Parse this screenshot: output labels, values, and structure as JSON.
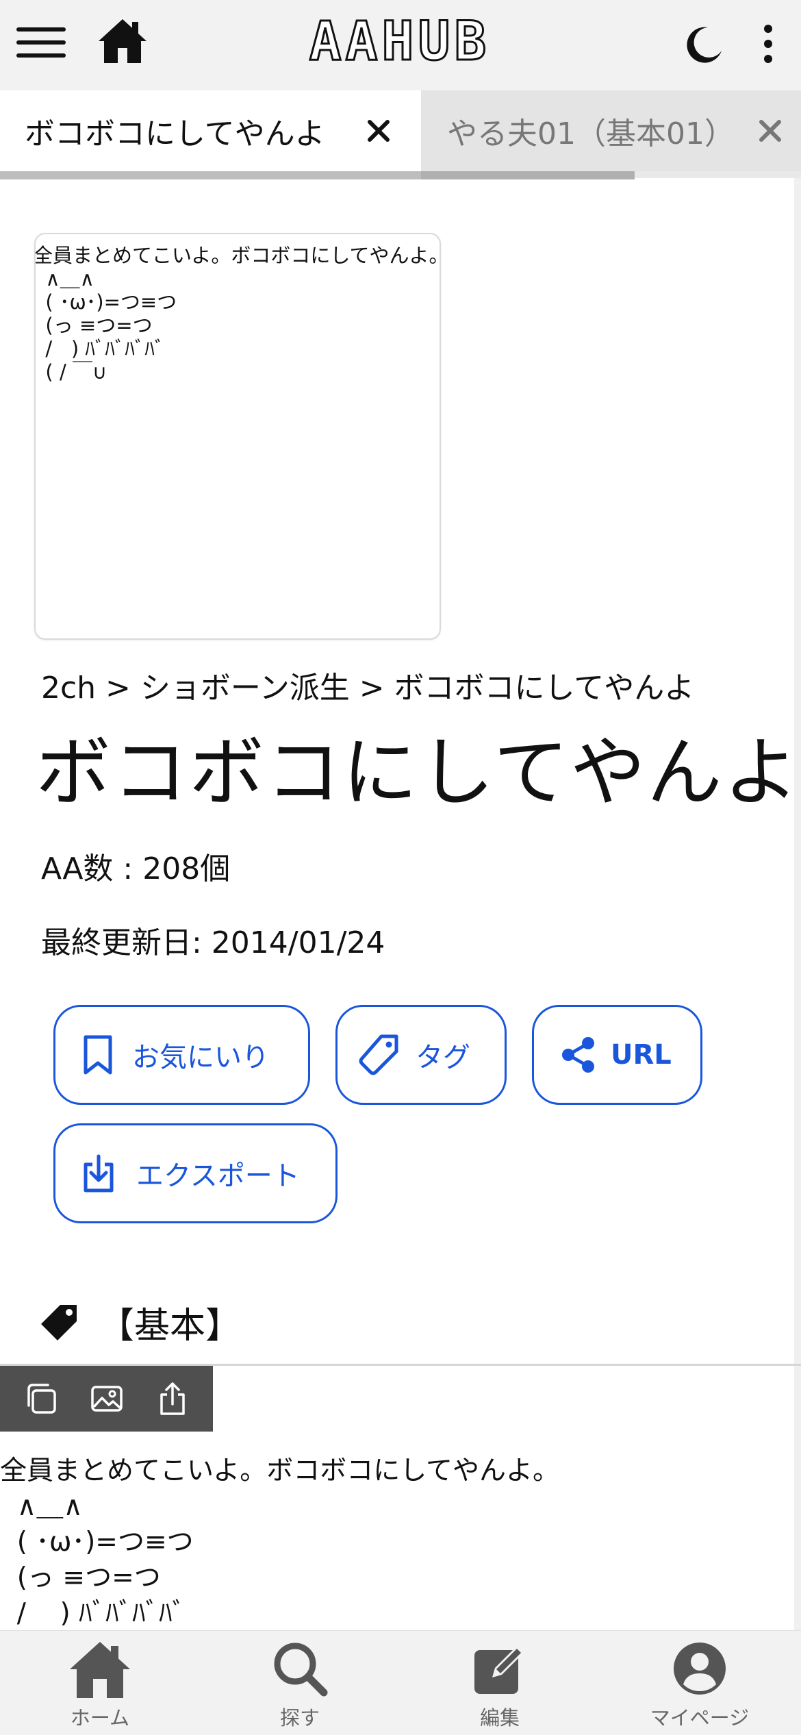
{
  "header": {
    "logo": "AAHUB"
  },
  "tabs": [
    {
      "label": "ボコボコにしてやんよ",
      "active": true
    },
    {
      "label": "やる夫01（基本01）",
      "active": false
    }
  ],
  "thumbnail": {
    "aa_lines": [
      "全員まとめてこいよ。ボコボコにしてやんよ。",
      "  ∧＿∧",
      "  ( ･ω･)=つ≡つ",
      "  (っ ≡つ=つ",
      "  /   ) ﾊﾞﾊﾞﾊﾞﾊﾞ",
      "  ( / ￣∪"
    ]
  },
  "breadcrumb": {
    "text": "2ch > ショボーン派生 > ボコボコにしてやんよ"
  },
  "page_title": "ボコボコにしてやんよ",
  "meta": {
    "aa_count": "AA数 : 208個",
    "last_updated": "最終更新日: 2014/01/24"
  },
  "actions": {
    "favorite": "お気にいり",
    "tag": "タグ",
    "url": "URL",
    "export": "エクスポート"
  },
  "tag_section": {
    "label": "【基本】"
  },
  "aa_item": {
    "lines": [
      "全員まとめてこいよ。ボコボコにしてやんよ。",
      "  ∧＿∧",
      "  ( ･ω･)=つ≡つ",
      "  (っ ≡つ=つ",
      "  /    ) ﾊﾞﾊﾞﾊﾞﾊﾞ"
    ]
  },
  "bottom_nav": [
    {
      "label": "ホーム"
    },
    {
      "label": "探す"
    },
    {
      "label": "編集"
    },
    {
      "label": "マイページ"
    }
  ],
  "colors": {
    "accent": "#1a56db",
    "header_bg": "#f2f2f2",
    "toolbar_bg": "#4f4f4f",
    "nav_icon": "#555555"
  }
}
